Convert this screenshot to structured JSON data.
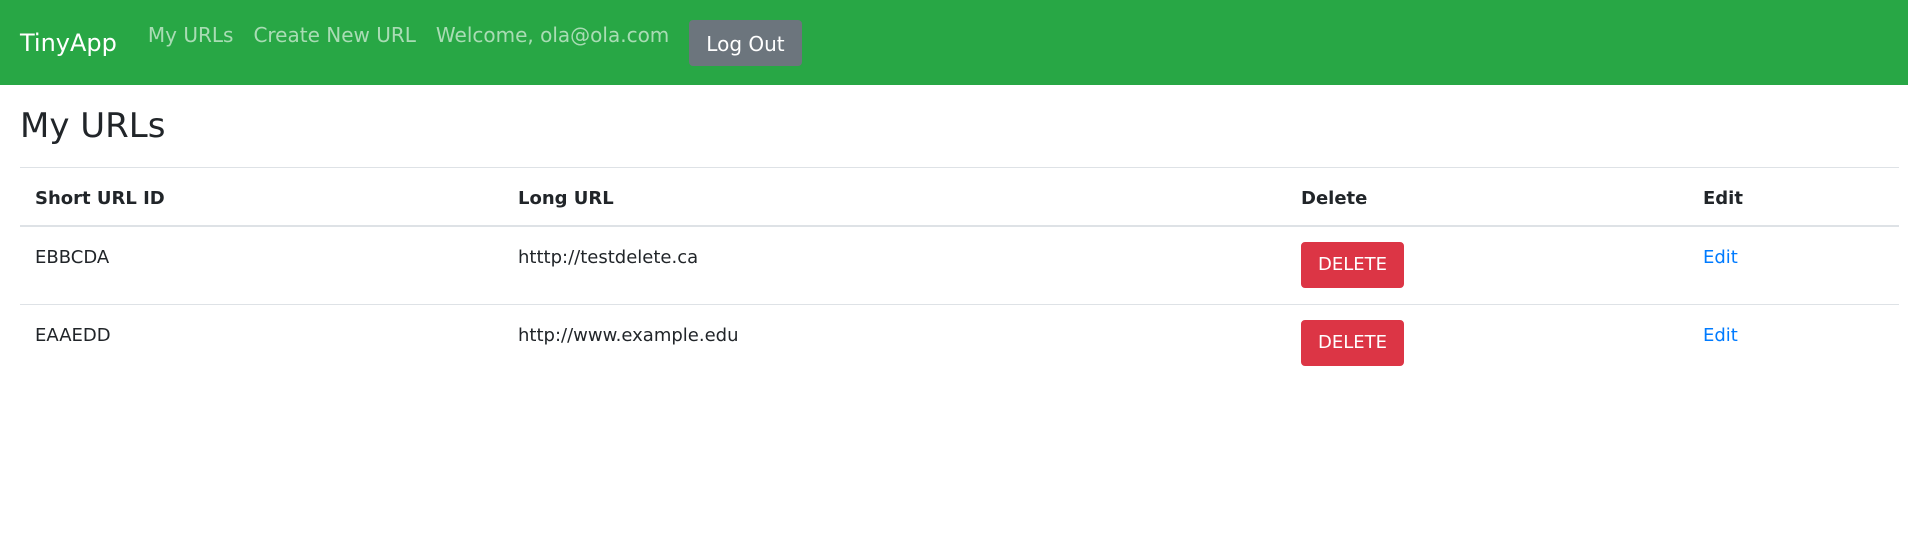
{
  "navbar": {
    "brand": "TinyApp",
    "links": [
      "My URLs",
      "Create New URL"
    ],
    "welcome": "Welcome, ola@ola.com",
    "logout_label": "Log Out"
  },
  "main": {
    "title": "My URLs",
    "table": {
      "headers": {
        "short_id": "Short URL ID",
        "long_url": "Long URL",
        "delete": "Delete",
        "edit": "Edit"
      },
      "rows": [
        {
          "short_id": "EBBCDA",
          "long_url": "htttp://testdelete.ca",
          "delete_label": "DELETE",
          "edit_label": "Edit"
        },
        {
          "short_id": "EAAEDD",
          "long_url": "http://www.example.edu",
          "delete_label": "DELETE",
          "edit_label": "Edit"
        }
      ]
    }
  },
  "colors": {
    "navbar": "#28a745",
    "logout": "#6c757d",
    "delete": "#dc3545",
    "link": "#007bff"
  }
}
